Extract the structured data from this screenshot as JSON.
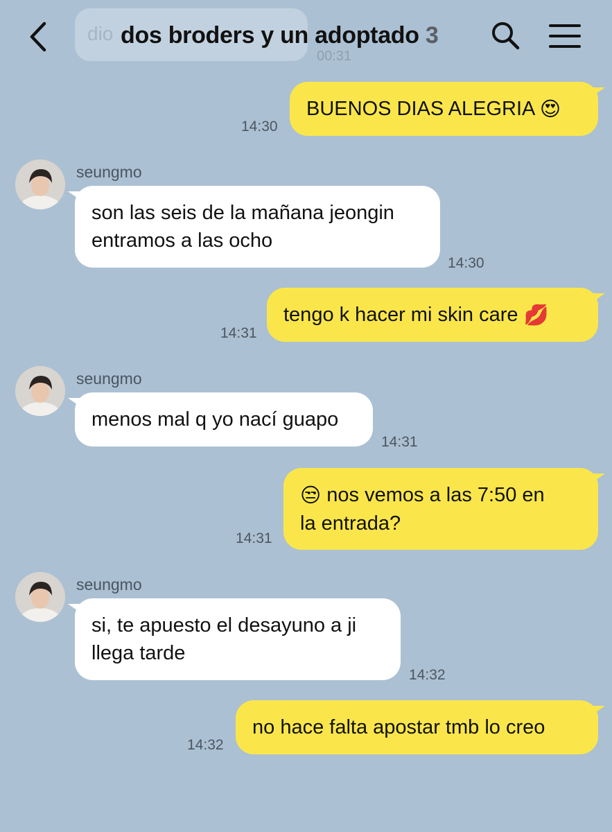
{
  "header": {
    "title": "dos broders y un adoptado",
    "member_count": "3",
    "ghost_preview_text": "dio",
    "ghost_preview_time": "00:31"
  },
  "icons": {
    "back": "chevron-left-icon",
    "search": "search-icon",
    "menu": "hamburger-menu-icon",
    "emoji_heart_eyes": "heart-eyes-emoji",
    "emoji_kiss": "kiss-mark-emoji",
    "emoji_unamused": "unamused-face-emoji"
  },
  "colors": {
    "background": "#abc0d3",
    "my_bubble": "#fae64b",
    "their_bubble": "#ffffff"
  },
  "messages": [
    {
      "from": "me",
      "text": "BUENOS DIAS ALEGRIA",
      "time": "14:30",
      "emoji": "😍"
    },
    {
      "from": "seungmo",
      "sender": "seungmo",
      "line1": "son las seis de la mañana jeongin",
      "line2": "entramos a las ocho",
      "time": "14:30"
    },
    {
      "from": "me",
      "text": "tengo k hacer mi skin care",
      "time": "14:31",
      "emoji": "💋"
    },
    {
      "from": "seungmo",
      "sender": "seungmo",
      "line1": "menos mal q yo nací guapo",
      "time": "14:31"
    },
    {
      "from": "me",
      "emoji": "😒",
      "line1": "nos vemos a las 7:50 en",
      "line2": "la entrada?",
      "time": "14:31"
    },
    {
      "from": "seungmo",
      "sender": "seungmo",
      "line1": "si, te apuesto el desayuno a ji",
      "line2": "llega tarde",
      "time": "14:32"
    },
    {
      "from": "me",
      "text": "no hace falta apostar tmb lo creo",
      "time": "14:32"
    }
  ]
}
